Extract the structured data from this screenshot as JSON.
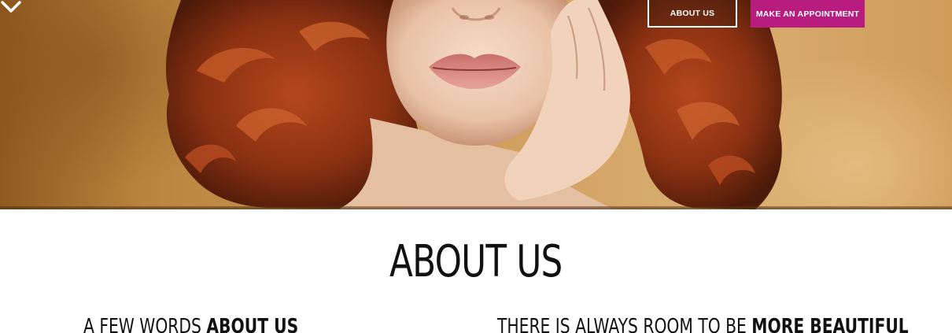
{
  "hero": {
    "about_button": "ABOUT US",
    "appointment_button": "MAKE AN APPOINTMENT",
    "accent_color": "#b81c7f",
    "scroll_icon": "chevron-down-icon"
  },
  "about": {
    "title": "ABOUT US",
    "left_heading_light": "A FEW WORDS ",
    "left_heading_bold": "ABOUT US",
    "right_heading_light": "THERE IS ALWAYS ROOM TO BE ",
    "right_heading_bold": "MORE BEAUTIFUL"
  }
}
